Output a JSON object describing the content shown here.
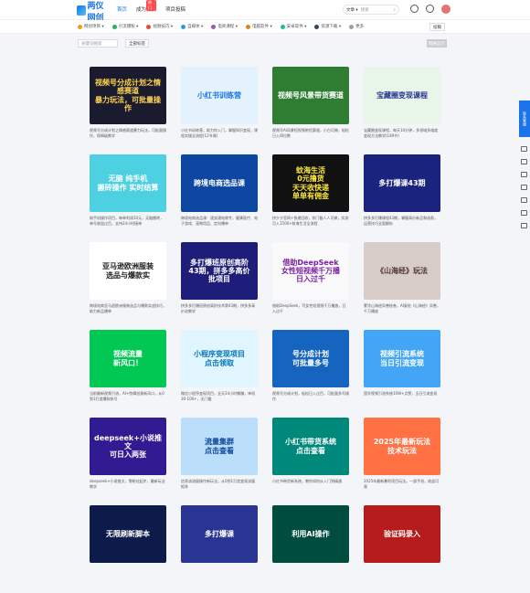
{
  "header": {
    "logo_text": "两仪网创",
    "nav": [
      {
        "label": "首页",
        "badge": ""
      },
      {
        "label": "成为会员",
        "badge": "热门"
      },
      {
        "label": "项目投稿",
        "badge": ""
      }
    ],
    "search": {
      "type_label": "文章 ▾",
      "placeholder": "搜索"
    }
  },
  "categories": [
    {
      "label": "网创项目 ▾",
      "color": "#f39c12"
    },
    {
      "label": "引流爆粉 ▾",
      "color": "#27ae60"
    },
    {
      "label": "视频技巧 ▾",
      "color": "#e74c3c"
    },
    {
      "label": "自媒体 ▾",
      "color": "#3498db"
    },
    {
      "label": "电商课程 ▾",
      "color": "#9b59b6"
    },
    {
      "label": "电脑软件 ▾",
      "color": "#e67e22"
    },
    {
      "label": "安卓软件 ▾",
      "color": "#1abc9c"
    },
    {
      "label": "资源下载 ▾",
      "color": "#34495e"
    },
    {
      "label": "更多",
      "color": "#95a5a6"
    }
  ],
  "submit_label": "投稿",
  "filter": {
    "input_placeholder": "关键词搜索",
    "button_label": "全部标签",
    "right_label": "网格显示"
  },
  "side_rail_label": "联系客服",
  "cards": [
    {
      "thumb_text": "视频号分成计划之情感赛道\n暴力玩法，可批量操作",
      "bg": "#1b1b2f",
      "fg": "#ffd54f",
      "desc": "视频号分成计划之情感赛道暴力玩法，可批量操作，保姆级教学"
    },
    {
      "thumb_text": "小红书训练营",
      "bg": "#e3f2fd",
      "fg": "#1a73e8",
      "desc": "小红书训练营，助力你入门，掌握知识变现，课程实操全流程(12节课)"
    },
    {
      "thumb_text": "视频号风景带货赛道",
      "bg": "#2e7d32",
      "fg": "#ffffff",
      "desc": "视频号AI风景短视频带货赛道，小白可做，轻松日入四位数"
    },
    {
      "thumb_text": "宝藏圈变现课程",
      "bg": "#e8f5e9",
      "fg": "#283593",
      "desc": "宝藏圈变现课程，每天10分钟，多领域多维度变现方法教学(189节)"
    },
    {
      "thumb_text": "无脑 纯手机\n搬砖操作 实时结算",
      "bg": "#4dd0e1",
      "fg": "#ffffff",
      "desc": "纯手机操作项目，每单利润10元，无脑搬砖，单号收益过百，支持24小时接单"
    },
    {
      "thumb_text": "跨境电商选品课",
      "bg": "#0d47a1",
      "fg": "#ffffff",
      "desc": "跨境电商选品课：速卖通电商专，健康医疗、电子游戏、宠物用品、定向爆单"
    },
    {
      "thumb_text": "蚊海生活\n0元撸货\n天天收快递\n单单有佣金",
      "bg": "#111111",
      "fg": "#ffeb3b",
      "desc": "拼夕夕官网+快递回收，你门槛人人可做，实测月入1500+蚊海生活全流程"
    },
    {
      "thumb_text": "多打爆课43期",
      "bg": "#1a237e",
      "fg": "#ffffff",
      "desc": "拼多多打爆课程43期，掌握高价新品和选款，运营技巧全面解析"
    },
    {
      "thumb_text": "亚马逊欧洲服装\n选品与爆款实",
      "bg": "#ffffff",
      "fg": "#222222",
      "desc": "跨境电商亚马逊欧洲服装选品与爆款实战技巧，助力新品爆单"
    },
    {
      "thumb_text": "多打爆班原创高阶\n43期，拼多多高价\n批项目",
      "bg": "#1e1e7a",
      "fg": "#ffffff",
      "desc": "拼多多打爆班原创高阶技术第43期，拼多多高价站教学"
    },
    {
      "thumb_text": "借助DeepSeek\n女性短视频千万播\n日入过千",
      "bg": "#fafafa",
      "fg": "#7b1fa2",
      "desc": "借助DeepSeek，写女性短视频千万播放，日入过千"
    },
    {
      "thumb_text": "《山海经》玩法",
      "bg": "#d7ccc8",
      "fg": "#4e342e",
      "desc": "蒙涂山海经异兽绘卷，AI复绘《山海经》异兽，千万播放"
    },
    {
      "thumb_text": "视频流量\n新风口！",
      "bg": "#00c853",
      "fg": "#ffffff",
      "desc": "当前最新视频引流，AI+剪辑创意新风口，从0到1打造爆款账号"
    },
    {
      "thumb_text": "小程序变现项目\n点击领取",
      "bg": "#e1f5fe",
      "fg": "#0277bd",
      "desc": "微信小程序变现项目，全天24小时躺赚，单机30-100+，无门槛"
    },
    {
      "thumb_text": "号分成计划\n可批量多号",
      "bg": "#1565c0",
      "fg": "#ffffff",
      "desc": "视频号分成计划，轻松日入过百，可批量多号操作"
    },
    {
      "thumb_text": "视频引流系统\n当日引流变现",
      "bg": "#42a5f5",
      "fg": "#ffffff",
      "desc": "国学视频引流系统10W+点赞，当日引流变现"
    },
    {
      "thumb_text": "deepseek+小说推文\n可日入两张",
      "bg": "#311b92",
      "fg": "#ffffff",
      "desc": "deepseek+小说推文，零粉丝起步，最新玩法教学"
    },
    {
      "thumb_text": "流量集群\n点击查看",
      "bg": "#bbdefb",
      "fg": "#0d47a1",
      "desc": "信息流流量操作新玩法，从0到1打造变现流量矩阵"
    },
    {
      "thumb_text": "小红书带货系统\n点击查看",
      "bg": "#00897b",
      "fg": "#ffffff",
      "desc": "小红书带货新系统，教你如何从入门到精通"
    },
    {
      "thumb_text": "2025年最新玩法\n技术玩法",
      "bg": "#ff7043",
      "fg": "#ffffff",
      "desc": "2025年最新暴利项目玩法，一部手机，收益可观"
    },
    {
      "thumb_text": "无限刷新脚本",
      "bg": "#0d1b4a",
      "fg": "#ffffff",
      "desc": ""
    },
    {
      "thumb_text": "多打爆课",
      "bg": "#283593",
      "fg": "#ffffff",
      "desc": ""
    },
    {
      "thumb_text": "利用AI操作",
      "bg": "#004d40",
      "fg": "#ffffff",
      "desc": ""
    },
    {
      "thumb_text": "验证码录入",
      "bg": "#b71c1c",
      "fg": "#ffffff",
      "desc": ""
    }
  ]
}
